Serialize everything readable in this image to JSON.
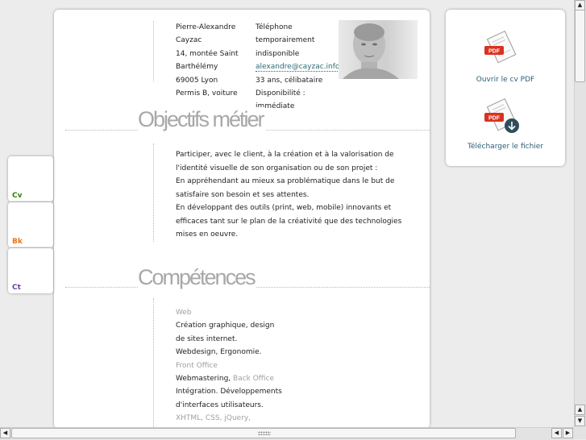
{
  "contact": {
    "name_line1": "Pierre-Alexandre",
    "name_line2": "Cayzac",
    "address_line1": "14, montée Saint",
    "address_line2": "Barthélémy",
    "city": "69005 Lyon",
    "license": "Permis B, voiture",
    "phone_line1": "Téléphone",
    "phone_line2": "temporairement",
    "phone_line3": "indisponible",
    "email": "alexandre@cayzac.info",
    "age_status": "33 ans, célibataire",
    "availability_line1": "Disponibilité :",
    "availability_line2": "immédiate"
  },
  "sections": {
    "objectifs_title": "Objectifs métier",
    "competences_title": "Compétences"
  },
  "objectifs": [
    "Participer, avec le client, à la création et à la valorisation de",
    "l'identité visuelle de son organisation ou de son projet :",
    "En appréhendant au mieux sa problématique dans le but de",
    "satisfaire son besoin et ses attentes.",
    "En développant des outils (print, web, mobile) innovants et",
    "efficaces tant sur le plan de la créativité que des technologies",
    "mises en oeuvre."
  ],
  "competences": {
    "web_label": "Web",
    "line1": "Création graphique, design",
    "line2": "de sites internet.",
    "line3": "Webdesign, Ergonomie.",
    "front_office_label": "Front Office",
    "webmastering": "Webmastering,",
    "back_office_label": "Back Office",
    "line5": "Intégration. Développements",
    "line6": "d'interfaces utilisateurs.",
    "tech_label": "XHTML, CSS, jQuery,"
  },
  "panel": {
    "open_pdf": "Ouvrir le cv PDF",
    "download": "Télécharger le fichier",
    "pdf_badge": "PDF"
  },
  "tabs": {
    "cv": "Cv",
    "bk": "Bk",
    "ct": "Ct"
  },
  "colors": {
    "tab_cv": "#2f7f10",
    "tab_bk": "#e8741a",
    "tab_ct": "#6a3fa0",
    "link": "#2b5f77",
    "pdf_red": "#d9321f"
  }
}
